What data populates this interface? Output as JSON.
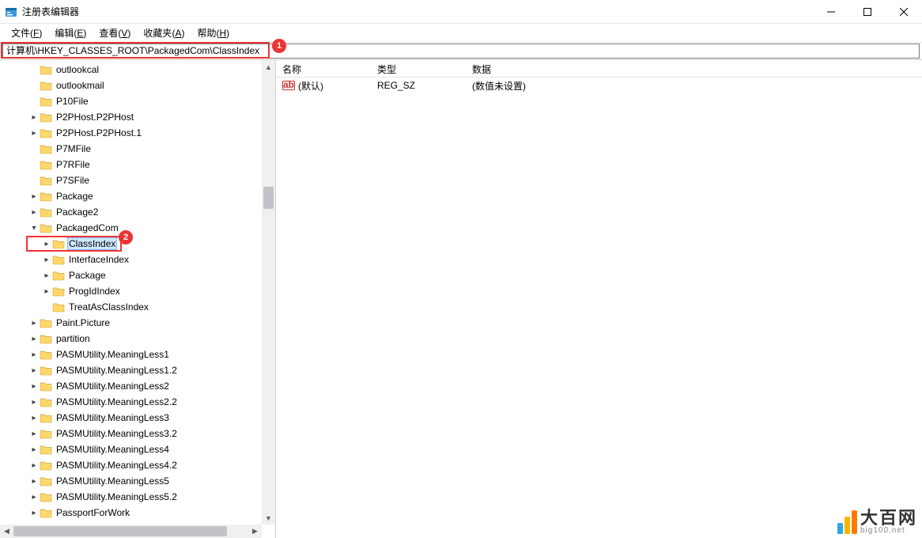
{
  "window": {
    "title": "注册表编辑器"
  },
  "menu": {
    "file": {
      "label": "文件",
      "hotkey": "F"
    },
    "edit": {
      "label": "编辑",
      "hotkey": "E"
    },
    "view": {
      "label": "查看",
      "hotkey": "V"
    },
    "fav": {
      "label": "收藏夹",
      "hotkey": "A"
    },
    "help": {
      "label": "帮助",
      "hotkey": "H"
    }
  },
  "address": {
    "path": "计算机\\HKEY_CLASSES_ROOT\\PackagedCom\\ClassIndex"
  },
  "callouts": {
    "addr": "1",
    "node": "2"
  },
  "tree": {
    "items": [
      {
        "indent": 2,
        "exp": "",
        "label": "outlookcal"
      },
      {
        "indent": 2,
        "exp": "",
        "label": "outlookmail"
      },
      {
        "indent": 2,
        "exp": "",
        "label": "P10File"
      },
      {
        "indent": 2,
        "exp": ">",
        "label": "P2PHost.P2PHost"
      },
      {
        "indent": 2,
        "exp": ">",
        "label": "P2PHost.P2PHost.1"
      },
      {
        "indent": 2,
        "exp": "",
        "label": "P7MFile"
      },
      {
        "indent": 2,
        "exp": "",
        "label": "P7RFile"
      },
      {
        "indent": 2,
        "exp": "",
        "label": "P7SFile"
      },
      {
        "indent": 2,
        "exp": ">",
        "label": "Package"
      },
      {
        "indent": 2,
        "exp": ">",
        "label": "Package2"
      },
      {
        "indent": 2,
        "exp": "v",
        "label": "PackagedCom"
      },
      {
        "indent": 3,
        "exp": ">",
        "label": "ClassIndex",
        "selected": true
      },
      {
        "indent": 3,
        "exp": ">",
        "label": "InterfaceIndex"
      },
      {
        "indent": 3,
        "exp": ">",
        "label": "Package"
      },
      {
        "indent": 3,
        "exp": ">",
        "label": "ProgIdIndex"
      },
      {
        "indent": 3,
        "exp": "",
        "label": "TreatAsClassIndex"
      },
      {
        "indent": 2,
        "exp": ">",
        "label": "Paint.Picture"
      },
      {
        "indent": 2,
        "exp": ">",
        "label": "partition"
      },
      {
        "indent": 2,
        "exp": ">",
        "label": "PASMUtility.MeaningLess1"
      },
      {
        "indent": 2,
        "exp": ">",
        "label": "PASMUtility.MeaningLess1.2"
      },
      {
        "indent": 2,
        "exp": ">",
        "label": "PASMUtility.MeaningLess2"
      },
      {
        "indent": 2,
        "exp": ">",
        "label": "PASMUtility.MeaningLess2.2"
      },
      {
        "indent": 2,
        "exp": ">",
        "label": "PASMUtility.MeaningLess3"
      },
      {
        "indent": 2,
        "exp": ">",
        "label": "PASMUtility.MeaningLess3.2"
      },
      {
        "indent": 2,
        "exp": ">",
        "label": "PASMUtility.MeaningLess4"
      },
      {
        "indent": 2,
        "exp": ">",
        "label": "PASMUtility.MeaningLess4.2"
      },
      {
        "indent": 2,
        "exp": ">",
        "label": "PASMUtility.MeaningLess5"
      },
      {
        "indent": 2,
        "exp": ">",
        "label": "PASMUtility.MeaningLess5.2"
      },
      {
        "indent": 2,
        "exp": ">",
        "label": "PassportForWork"
      }
    ]
  },
  "list": {
    "columns": {
      "name": "名称",
      "type": "类型",
      "data": "数据"
    },
    "colwidths": {
      "name": 120,
      "type": 120,
      "data": 300
    },
    "rows": [
      {
        "name": "(默认)",
        "type": "REG_SZ",
        "data": "(数值未设置)"
      }
    ]
  },
  "watermark": {
    "cn": "大百网",
    "en": "big100.net"
  }
}
